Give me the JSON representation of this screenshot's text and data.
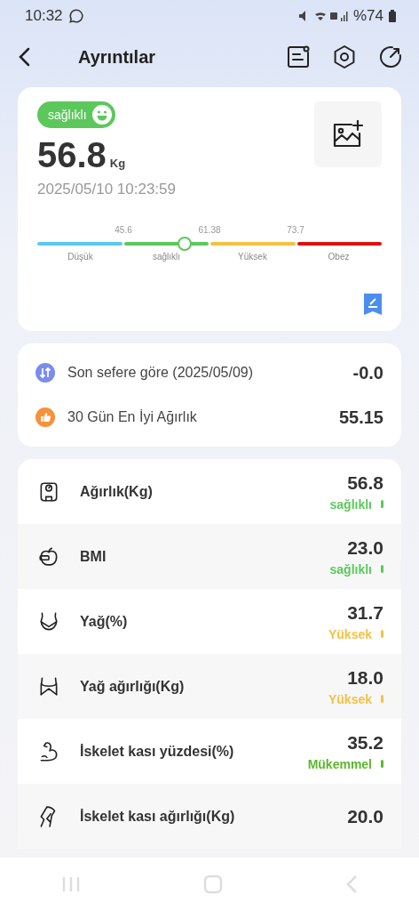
{
  "status_bar": {
    "time": "10:32",
    "battery": "%74"
  },
  "header": {
    "title": "Ayrıntılar"
  },
  "summary": {
    "badge": "sağlıklı",
    "weight": "56.8",
    "unit": "Kg",
    "datetime": "2025/05/10 10:23:59",
    "gauge": {
      "level": 0.427,
      "thresholds": [
        "45.6",
        "61.38",
        "73.7"
      ],
      "segments": [
        {
          "label": "Düşük",
          "color": "#5bc8f0"
        },
        {
          "label": "sağlıklı",
          "color": "#5cc85c"
        },
        {
          "label": "Yüksek",
          "color": "#f5c242"
        },
        {
          "label": "Obez",
          "color": "#e01010"
        }
      ]
    }
  },
  "comparisons": [
    {
      "kind": "change",
      "label": "Son sefere göre (2025/05/09)",
      "value": "-0.0"
    },
    {
      "kind": "best",
      "label": "30 Gün En İyi Ağırlık",
      "value": "55.15"
    }
  ],
  "metrics": [
    {
      "kind": "scale",
      "label": "Ağırlık(Kg)",
      "value": "56.8",
      "status": "sağlıklı",
      "color": "#5cc85c"
    },
    {
      "kind": "bmi",
      "label": "BMI",
      "value": "23.0",
      "status": "sağlıklı",
      "color": "#5cc85c"
    },
    {
      "kind": "fat",
      "label": "Yağ(%)",
      "value": "31.7",
      "status": "Yüksek",
      "color": "#f5c242"
    },
    {
      "kind": "fatweight",
      "label": "Yağ ağırlığı(Kg)",
      "value": "18.0",
      "status": "Yüksek",
      "color": "#f5c242"
    },
    {
      "kind": "muscle",
      "label": "İskelet kası yüzdesi(%)",
      "value": "35.2",
      "status": "Mükemmel",
      "color": "#5cb82a"
    },
    {
      "kind": "musclemass",
      "label": "İskelet kası ağırlığı(Kg)",
      "value": "20.0"
    }
  ]
}
